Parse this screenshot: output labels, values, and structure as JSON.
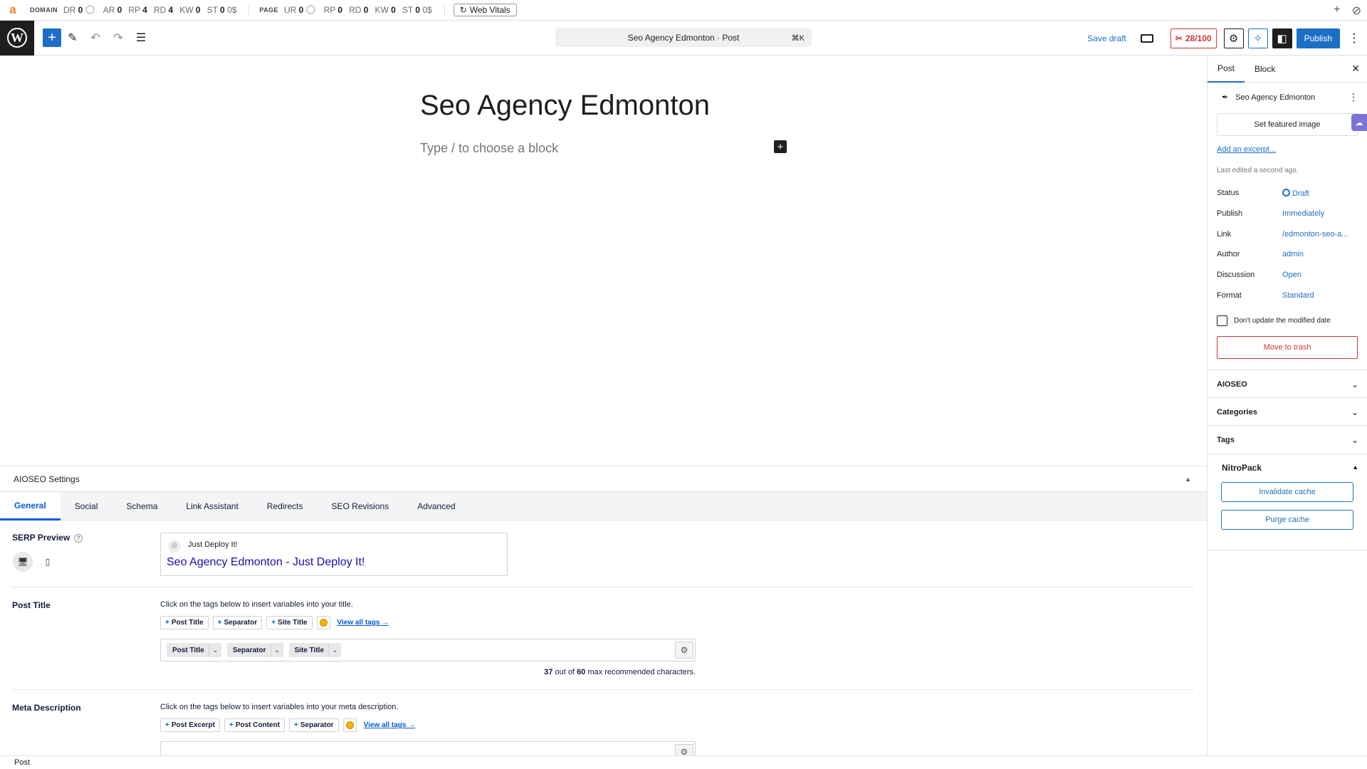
{
  "ahrefs": {
    "logo": "a",
    "domain_label": "DOMAIN",
    "page_label": "PAGE",
    "domain_metrics": [
      {
        "key": "DR",
        "value": "0",
        "circle": true
      },
      {
        "key": "AR",
        "value": "0"
      },
      {
        "key": "RP",
        "value": "4"
      },
      {
        "key": "RD",
        "value": "4"
      },
      {
        "key": "KW",
        "value": "0"
      },
      {
        "key": "ST",
        "value": "0",
        "suffix": "0$"
      }
    ],
    "page_metrics": [
      {
        "key": "UR",
        "value": "0",
        "circle": true
      },
      {
        "key": "RP",
        "value": "0"
      },
      {
        "key": "RD",
        "value": "0"
      },
      {
        "key": "KW",
        "value": "0"
      },
      {
        "key": "ST",
        "value": "0",
        "suffix": "0$"
      }
    ],
    "web_vitals": "Web Vitals"
  },
  "header": {
    "command_title": "Seo Agency Edmonton · Post",
    "command_shortcut": "⌘K",
    "save_draft": "Save draft",
    "seo_score": "28/100",
    "publish": "Publish"
  },
  "editor": {
    "title": "Seo Agency Edmonton",
    "placeholder": "Type / to choose a block"
  },
  "sidebar": {
    "tab_post": "Post",
    "tab_block": "Block",
    "post_title": "Seo Agency Edmonton",
    "featured_image": "Set featured image",
    "add_excerpt": "Add an excerpt...",
    "last_edited": "Last edited a second ago.",
    "summary": {
      "status_label": "Status",
      "status_value": "Draft",
      "publish_label": "Publish",
      "publish_value": "Immediately",
      "link_label": "Link",
      "link_value": "/edmonton-seo-a...",
      "author_label": "Author",
      "author_value": "admin",
      "discussion_label": "Discussion",
      "discussion_value": "Open",
      "format_label": "Format",
      "format_value": "Standard"
    },
    "dont_update": "Don't update the modified date",
    "move_to_trash": "Move to trash",
    "panels": [
      "AIOSEO",
      "Categories",
      "Tags"
    ],
    "nitropack": {
      "title": "NitroPack",
      "invalidate": "Invalidate cache",
      "purge": "Purge cache"
    }
  },
  "aioseo": {
    "heading": "AIOSEO Settings",
    "tabs": [
      "General",
      "Social",
      "Schema",
      "Link Assistant",
      "Redirects",
      "SEO Revisions",
      "Advanced"
    ],
    "serp": {
      "label": "SERP Preview",
      "site_name": "Just Deploy It!",
      "title": "Seo Agency Edmonton - Just Deploy It!"
    },
    "post_title": {
      "label": "Post Title",
      "hint": "Click on the tags below to insert variables into your title.",
      "tags": [
        "Post Title",
        "Separator",
        "Site Title"
      ],
      "view_all": "View all tags →",
      "chips": [
        "Post Title",
        "Separator",
        "Site Title"
      ],
      "count": "37",
      "count_mid": "out of",
      "max": "60",
      "count_tail": "max recommended characters."
    },
    "meta_description": {
      "label": "Meta Description",
      "hint": "Click on the tags below to insert variables into your meta description.",
      "tags": [
        "Post Excerpt",
        "Post Content",
        "Separator"
      ],
      "view_all": "View all tags →"
    }
  },
  "footer": {
    "breadcrumb": "Post"
  }
}
